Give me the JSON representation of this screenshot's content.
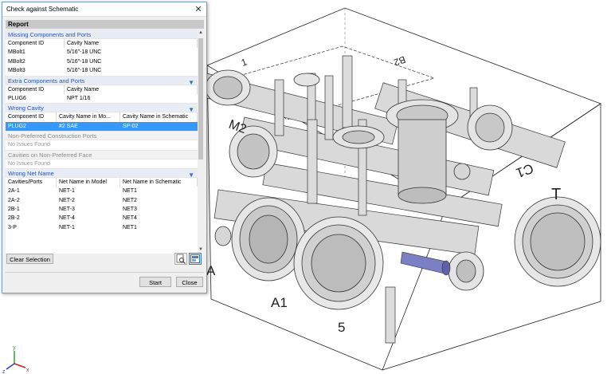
{
  "dialog": {
    "title": "Check against Schematic",
    "report_header": "Report",
    "clear_selection_label": "Clear Selection",
    "start_label": "Start",
    "close_label": "Close"
  },
  "sections": {
    "missing": {
      "title": "Missing Components and Ports",
      "headers": [
        "Component ID",
        "Cavity Name"
      ],
      "rows": [
        [
          "MBolt1",
          "5/16\"-18 UNC"
        ],
        [
          "MBolt2",
          "5/16\"-18 UNC"
        ],
        [
          "MBolt3",
          "5/16\"-18 UNC"
        ]
      ]
    },
    "extra": {
      "title": "Extra Components and Ports",
      "headers": [
        "Component ID",
        "Cavity Name"
      ],
      "rows": [
        [
          "PLUG6",
          "NPT 1/16"
        ]
      ]
    },
    "wrong_cavity": {
      "title": "Wrong Cavity",
      "headers": [
        "Component ID",
        "Cavity Name in Mo...",
        "Cavity Name in Schematic"
      ],
      "rows": [
        [
          "PLUG2",
          "#2 SAE",
          "SP-02"
        ]
      ]
    },
    "non_preferred": {
      "title": "Non-Preferred Construction Ports",
      "note": "No Issues Found"
    },
    "non_preferred_face": {
      "title": "Cavities on Non-Preferred Face",
      "note": "No Issues Found"
    },
    "wrong_net": {
      "title": "Wrong Net Name",
      "headers": [
        "Cavities/Ports",
        "Net Name in Model",
        "Net Name in Schematic"
      ],
      "rows": [
        [
          "2A-1",
          "NET-1",
          "NET1"
        ],
        [
          "2A-2",
          "NET-2",
          "NET2"
        ],
        [
          "2B-1",
          "NET-3",
          "NET3"
        ],
        [
          "2B-2",
          "NET-4",
          "NET4"
        ],
        [
          "3-P",
          "NET-1",
          "NET1"
        ]
      ]
    }
  },
  "model_labels": {
    "t": "T",
    "c1": "C1",
    "a1": "A1",
    "five": "5",
    "a": "A",
    "b2": "B2",
    "m2": "M2",
    "top1": "1"
  },
  "axes": {
    "x": "x",
    "y": "y",
    "z": "z"
  },
  "colors": {
    "selection": "#3399ff",
    "section_blue": "#2a55b8",
    "model_gray": "#d6d6d6",
    "highlight_part": "#7b7fc4"
  }
}
